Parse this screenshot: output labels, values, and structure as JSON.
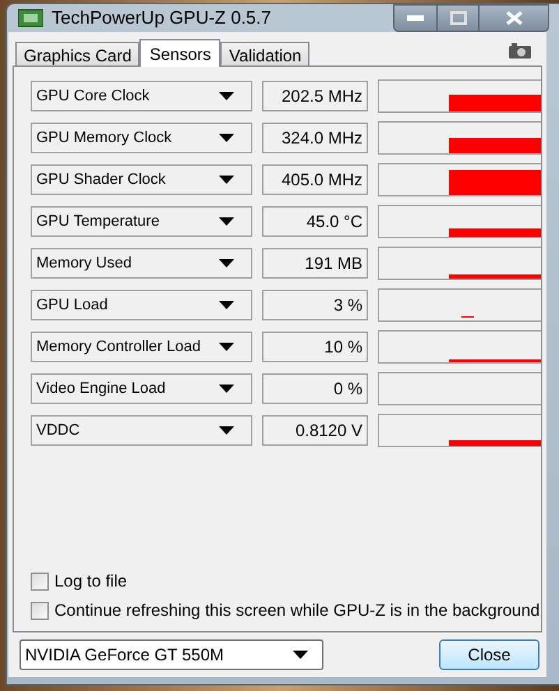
{
  "window": {
    "title": "TechPowerUp GPU-Z 0.5.7"
  },
  "tabs": [
    {
      "label": "Graphics Card",
      "selected": false
    },
    {
      "label": "Sensors",
      "selected": true
    },
    {
      "label": "Validation",
      "selected": false
    }
  ],
  "sensors": [
    {
      "name": "GPU Core Clock",
      "value": "202.5 MHz"
    },
    {
      "name": "GPU Memory Clock",
      "value": "324.0 MHz"
    },
    {
      "name": "GPU Shader Clock",
      "value": "405.0 MHz"
    },
    {
      "name": "GPU Temperature",
      "value": "45.0 °C"
    },
    {
      "name": "Memory Used",
      "value": "191 MB"
    },
    {
      "name": "GPU Load",
      "value": "3 %"
    },
    {
      "name": "Memory Controller Load",
      "value": "10 %"
    },
    {
      "name": "Video Engine Load",
      "value": "0 %"
    },
    {
      "name": "VDDC",
      "value": "0.8120 V"
    }
  ],
  "options": [
    {
      "label": "Log to file",
      "checked": false
    },
    {
      "label": "Continue refreshing this screen while GPU-Z is in the background",
      "checked": false
    }
  ],
  "device_select": {
    "value": "NVIDIA GeForce GT 550M"
  },
  "buttons": [
    "Close"
  ]
}
